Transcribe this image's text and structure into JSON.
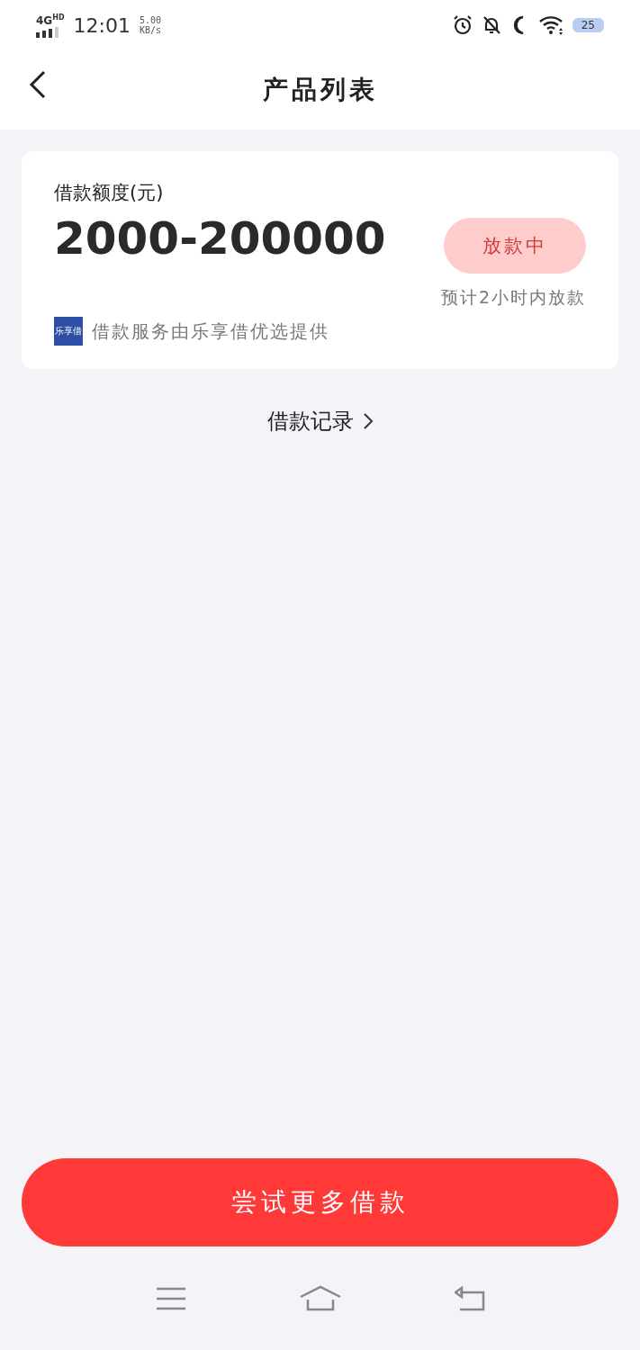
{
  "status_bar": {
    "network": "4G",
    "network_badge": "HD",
    "time": "12:01",
    "speed_value": "5.00",
    "speed_unit": "KB/s",
    "battery": "25"
  },
  "header": {
    "title": "产品列表"
  },
  "product_card": {
    "label": "借款额度(元)",
    "amount": "2000-200000",
    "status_button": {
      "label": "放款中",
      "disabled": true
    },
    "eta": "预计2小时内放款",
    "provider_logo": "乐享借",
    "provider_text": "借款服务由乐享借优选提供"
  },
  "records_link": {
    "label": "借款记录"
  },
  "primary_button": {
    "label": "尝试更多借款"
  }
}
